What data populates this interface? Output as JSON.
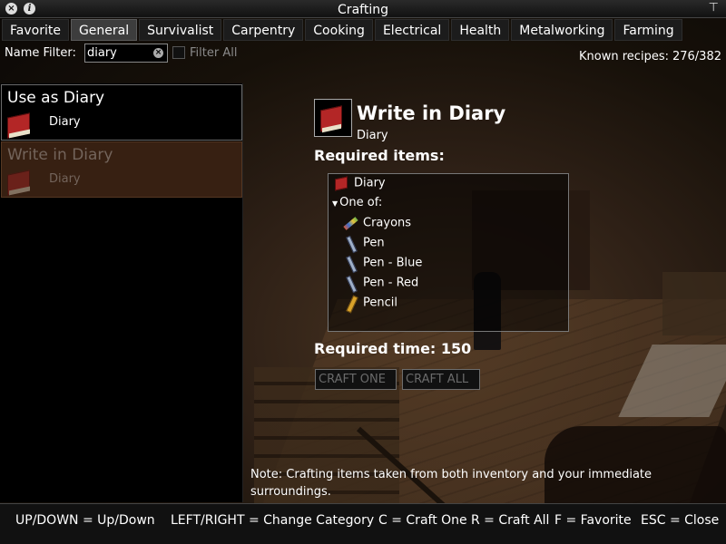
{
  "window": {
    "title": "Crafting"
  },
  "tabs": [
    {
      "label": "Favorite"
    },
    {
      "label": "General"
    },
    {
      "label": "Survivalist"
    },
    {
      "label": "Carpentry"
    },
    {
      "label": "Cooking"
    },
    {
      "label": "Electrical"
    },
    {
      "label": "Health"
    },
    {
      "label": "Metalworking"
    },
    {
      "label": "Farming"
    }
  ],
  "active_tab": "General",
  "filter": {
    "label": "Name Filter:",
    "value": "diary",
    "filter_all_label": "Filter All",
    "filter_all_checked": false
  },
  "known_recipes": {
    "label": "Known recipes:",
    "value": "276/382"
  },
  "recipes": [
    {
      "name": "Use as Diary",
      "item": "Diary",
      "icon": "book-icon",
      "selected": false,
      "available": true
    },
    {
      "name": "Write in Diary",
      "item": "Diary",
      "icon": "book-icon",
      "selected": true,
      "available": false
    }
  ],
  "detail": {
    "title": "Write in Diary",
    "subtitle": "Diary",
    "icon": "book-icon",
    "required_items_label": "Required items:",
    "required_items": [
      {
        "label": "Diary",
        "icon": "book-icon"
      }
    ],
    "one_of_label": "One of:",
    "one_of_items": [
      {
        "label": "Crayons",
        "icon": "crayons-icon"
      },
      {
        "label": "Pen",
        "icon": "pen-icon"
      },
      {
        "label": "Pen - Blue",
        "icon": "pen-icon"
      },
      {
        "label": "Pen - Red",
        "icon": "pen-icon"
      },
      {
        "label": "Pencil",
        "icon": "pencil-icon"
      }
    ],
    "required_time_label": "Required time:",
    "required_time": "150",
    "buttons": {
      "craft_one": "CRAFT ONE",
      "craft_all": "CRAFT ALL"
    }
  },
  "note": "Note: Crafting items taken from both inventory and your immediate surroundings.",
  "footer_hints": [
    "UP/DOWN = Up/Down",
    "LEFT/RIGHT = Change Category",
    "C = Craft One",
    "R = Craft All",
    "F = Favorite",
    "ESC = Close"
  ]
}
